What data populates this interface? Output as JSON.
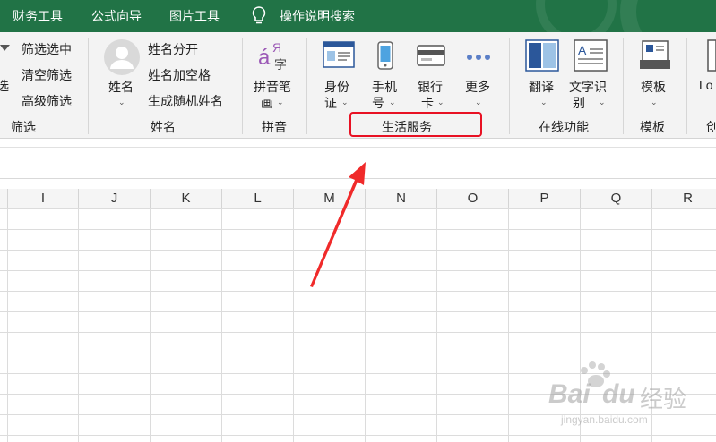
{
  "tabs": [
    "财务工具",
    "公式向导",
    "图片工具",
    "操作说明搜索"
  ],
  "filter": {
    "items": [
      "筛选选中",
      "清空筛选",
      "高级筛选"
    ],
    "cut_text": "选",
    "group_label": "筛选"
  },
  "name": {
    "big_button": "姓名",
    "items": [
      "姓名分开",
      "姓名加空格",
      "生成随机姓名"
    ],
    "group_label": "姓名"
  },
  "pinyin": {
    "icon_glyph_a": "á",
    "icon_glyph_b": "字",
    "icon_glyph_c": "Я",
    "button_line1": "拼音笔",
    "button_line2": "画",
    "group_label": "拼音"
  },
  "life": {
    "buttons": [
      {
        "line1": "身份",
        "line2": "证"
      },
      {
        "line1": "手机",
        "line2": "号"
      },
      {
        "line1": "银行",
        "line2": "卡"
      },
      {
        "line1": "更多",
        "line2": ""
      }
    ],
    "group_label": "生活服务"
  },
  "online": {
    "buttons": [
      {
        "line1": "翻译",
        "line2": ""
      },
      {
        "line1": "文字识",
        "line2": "别"
      }
    ],
    "group_label": "在线功能"
  },
  "template": {
    "button": "模板",
    "group_label": "模板"
  },
  "cut": {
    "button": "Lo",
    "label": "创"
  },
  "columns": [
    "I",
    "J",
    "K",
    "L",
    "M",
    "N",
    "O",
    "P",
    "Q",
    "R"
  ],
  "watermark": {
    "logo": "Bai",
    "logo2": "du",
    "cn": "经验",
    "url": "jingyan.baidu.com"
  },
  "colors": {
    "ribbon_tab_bg": "#217346",
    "highlight": "#e81123",
    "arrow": "#f02a2a"
  }
}
